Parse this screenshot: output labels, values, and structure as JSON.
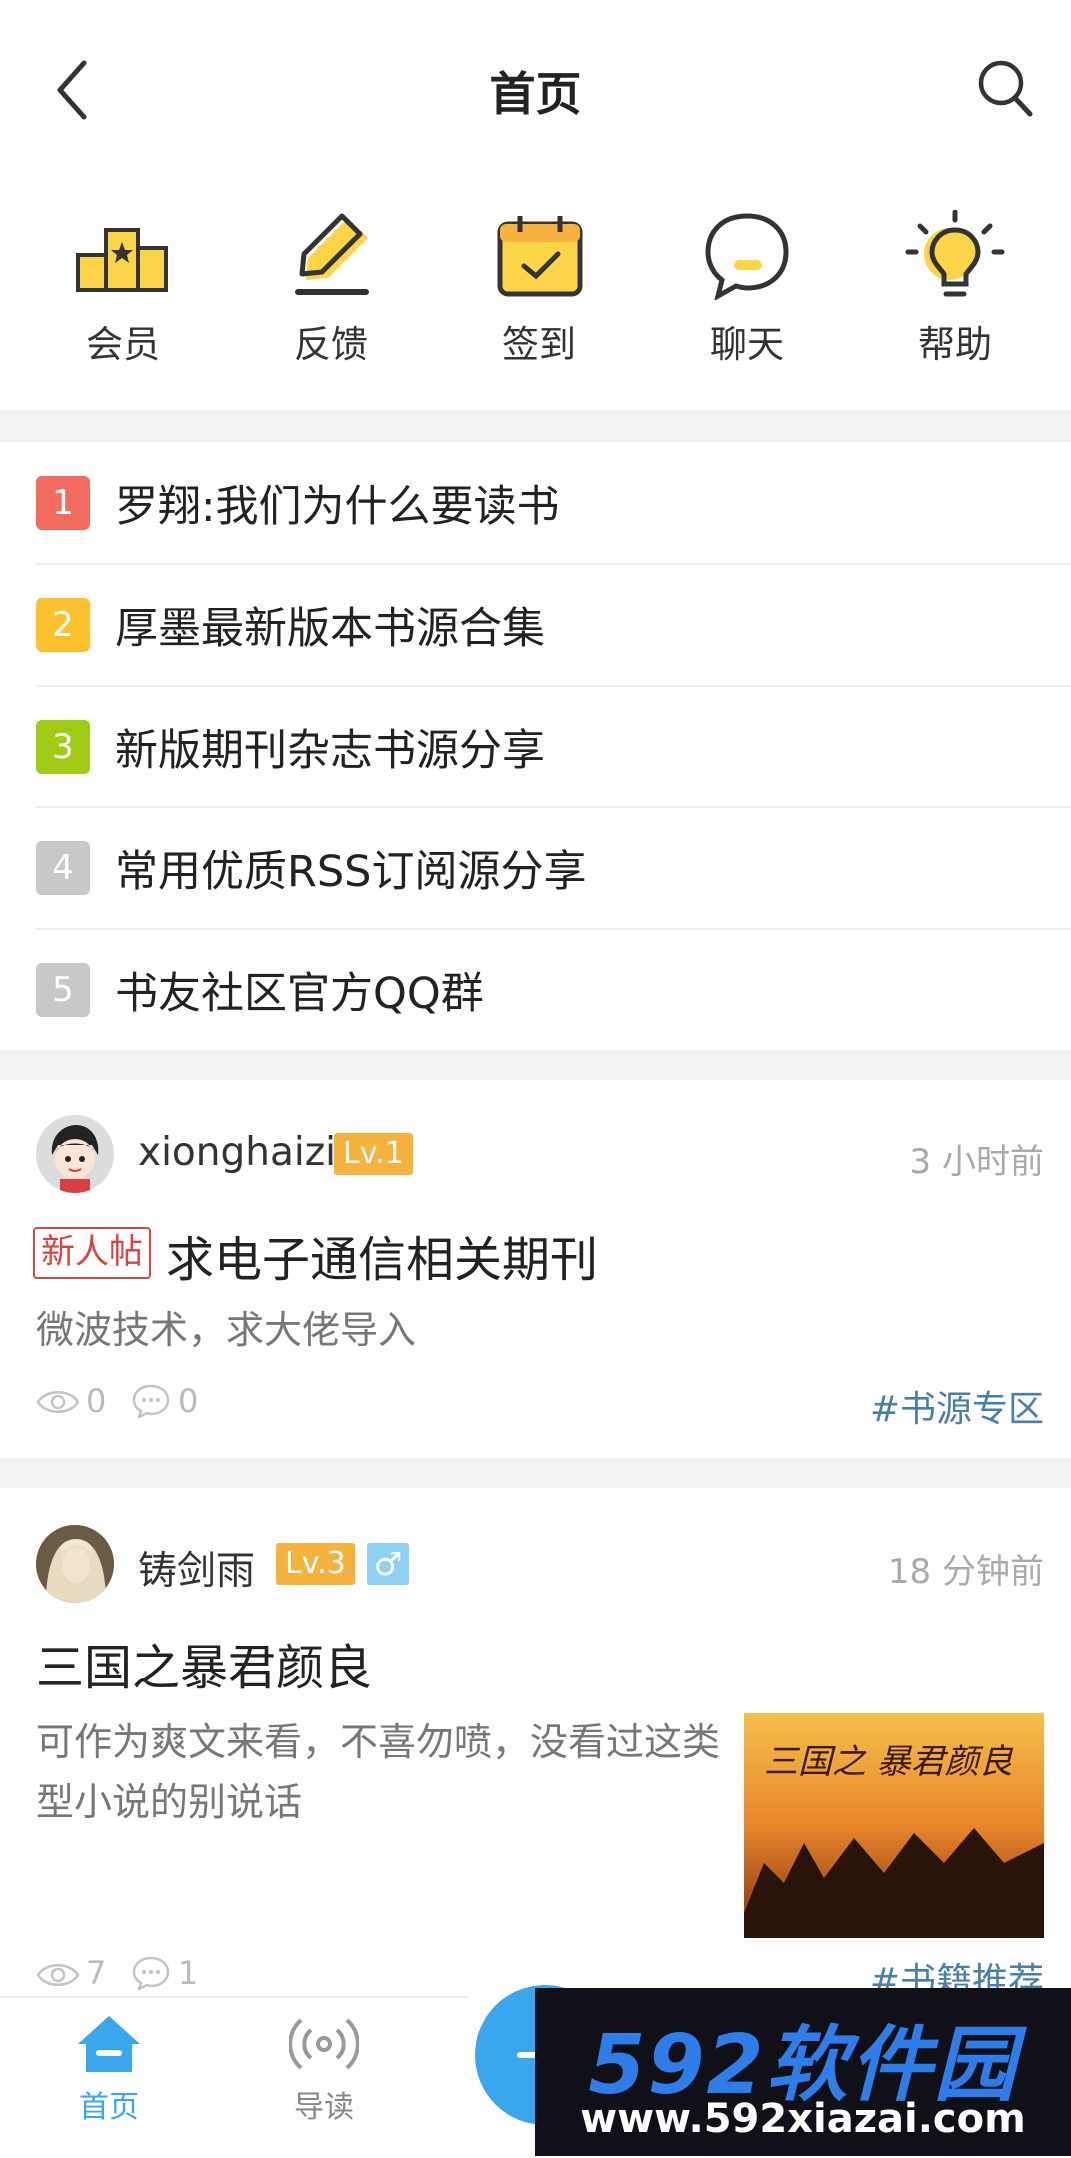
{
  "header": {
    "title": "首页"
  },
  "quick_actions": [
    {
      "label": "会员",
      "icon": "podium-icon"
    },
    {
      "label": "反馈",
      "icon": "edit-icon"
    },
    {
      "label": "签到",
      "icon": "calendar-check-icon"
    },
    {
      "label": "聊天",
      "icon": "chat-icon"
    },
    {
      "label": "帮助",
      "icon": "lightbulb-icon"
    }
  ],
  "ranked_list": [
    {
      "rank": "1",
      "text": "罗翔:我们为什么要读书",
      "color": "#f46b5f"
    },
    {
      "rank": "2",
      "text": "厚墨最新版本书源合集",
      "color": "#fbc22d"
    },
    {
      "rank": "3",
      "text": "新版期刊杂志书源分享",
      "color": "#a2cb16"
    },
    {
      "rank": "4",
      "text": "常用优质RSS订阅源分享",
      "color": "#c8c8c8"
    },
    {
      "rank": "5",
      "text": "书友社区官方QQ群",
      "color": "#c8c8c8"
    }
  ],
  "posts": [
    {
      "username": "xionghaizi",
      "level": "Lv.1",
      "time": "3 小时前",
      "tag": "新人帖",
      "title": "求电子通信相关期刊",
      "excerpt": "微波技术，求大佬导入",
      "views": "0",
      "comments": "0",
      "topic": "#书源专区"
    },
    {
      "username": "铸剑雨",
      "level": "Lv.3",
      "gender": "♂",
      "time": "18 分钟前",
      "title": "三国之暴君颜良",
      "excerpt": "可作为爽文来看，不喜勿喷，没看过这类型小说的别说话",
      "thumb_title": "三国之 暴君颜良",
      "views": "7",
      "comments": "1",
      "topic": "#书籍推荐"
    }
  ],
  "bottom_nav": [
    {
      "label": "首页",
      "icon": "home-icon",
      "active": true
    },
    {
      "label": "导读",
      "icon": "broadcast-icon",
      "active": false
    }
  ],
  "colors": {
    "accent": "#3aa6ee",
    "icon_yellow": "#fbd448"
  },
  "watermark": {
    "brand": "592软件园",
    "url": "www.592xiazai.com"
  }
}
